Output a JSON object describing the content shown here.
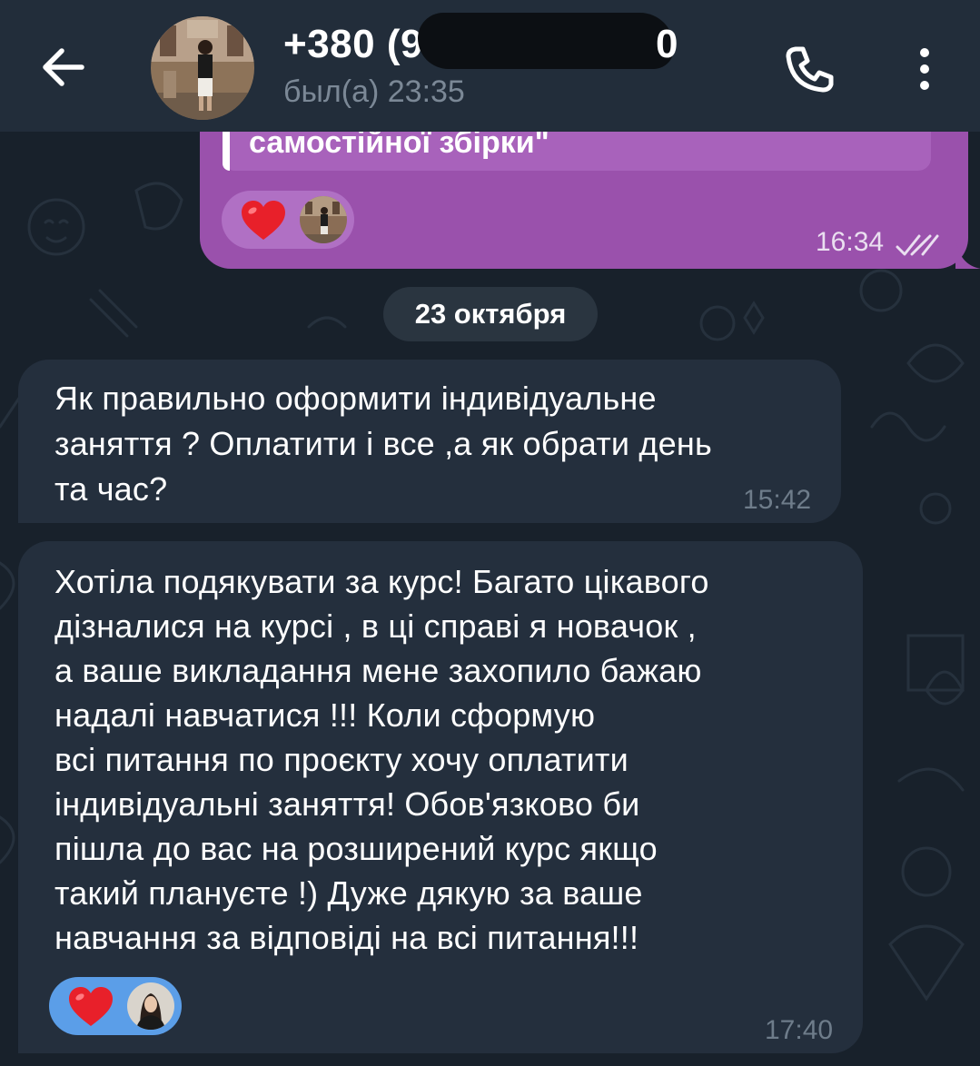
{
  "header": {
    "contact_name": "+380 (9",
    "contact_name_suffix": "0",
    "last_seen": "был(а) 23:35",
    "back_icon": "arrow-left-icon",
    "call_icon": "phone-icon",
    "menu_icon": "more-vertical-icon"
  },
  "outgoing_message": {
    "quote_text": "самостійної збірки\"",
    "reaction_emoji": "heart",
    "time": "16:34",
    "status": "read",
    "bubble_color": "#9a51ac"
  },
  "date_separator": "23 октября",
  "incoming_messages": [
    {
      "lines": [
        "Як правильно оформити індивідуальне",
        "заняття ? Оплатити і все ,а як обрати день",
        "та час?"
      ],
      "time": "15:42"
    },
    {
      "lines": [
        "Хотіла подякувати за курс! Багато цікавого",
        "дізналися на курсі , в ці справі я новачок ,",
        "а ваше викладання мене захопило  бажаю",
        "надалі навчатися !!! Коли сформую",
        "всі питання по проєкту хочу оплатити",
        "індивідуальні заняття! Обов'язково би",
        "пішла до вас на розширений курс якщо",
        "такий плануєте !) Дуже дякую за ваше",
        "навчання за відповіді на всі питання!!!"
      ],
      "reaction_emoji": "heart",
      "time": "17:40"
    }
  ],
  "colors": {
    "background": "#18212b",
    "header": "#222d3a",
    "incoming_bubble": "#242f3d",
    "reaction_pill_incoming": "#5b9ee8"
  }
}
